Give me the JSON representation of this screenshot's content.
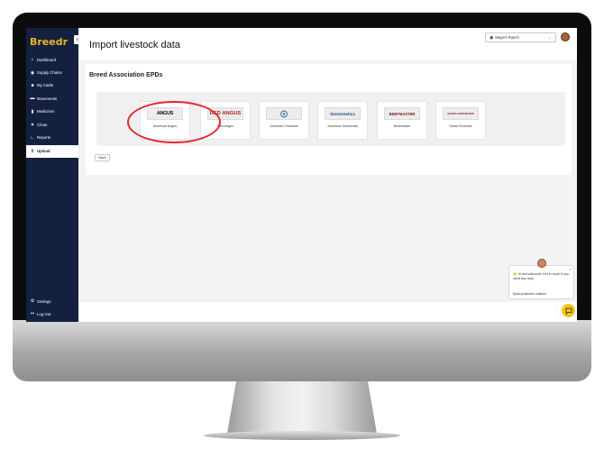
{
  "app": {
    "logo": "Breedr",
    "page_title": "Import livestock data"
  },
  "sidebar": {
    "collapse_icon": "chevron-left-icon",
    "items": [
      {
        "label": "Dashboard",
        "icon": "home-icon"
      },
      {
        "label": "Supply Chains",
        "icon": "eye-icon"
      },
      {
        "label": "My Cattle",
        "icon": "cow-icon"
      },
      {
        "label": "Movements",
        "icon": "truck-icon"
      },
      {
        "label": "Medicines",
        "icon": "bottle-icon"
      },
      {
        "label": "Chute",
        "icon": "barn-icon"
      },
      {
        "label": "Reports",
        "icon": "chart-icon"
      },
      {
        "label": "Upload",
        "icon": "upload-icon",
        "active": true
      }
    ],
    "bottom": [
      {
        "label": "Settings",
        "icon": "gear-icon"
      },
      {
        "label": "Log Out",
        "icon": "logout-icon"
      }
    ]
  },
  "header": {
    "ranch_selector": "Maya's Ranch"
  },
  "main": {
    "section_title": "Breed Association EPDs",
    "breeds": [
      {
        "label": "American Angus",
        "logo_text": "ANGUS"
      },
      {
        "label": "Red Angus",
        "logo_text": "RED ANGUS"
      },
      {
        "label": "American Charolais",
        "logo_text": ""
      },
      {
        "label": "American Simmental",
        "logo_text": "SimGenetics"
      },
      {
        "label": "Beefmaster",
        "logo_text": "BEEFMASTER"
      },
      {
        "label": "Santa Gertrudis",
        "logo_text": "SANTA GERTRUDIS"
      }
    ],
    "back_label": "Back"
  },
  "chat": {
    "message": "Hi and welcome! Get in touch if you need any help.",
    "wave": "👋",
    "spam_notice": "Spam protection enabled"
  },
  "colors": {
    "sidebar_bg": "#13213f",
    "accent": "#f0b323",
    "highlight": "#e6252b",
    "chat_button": "#f7c418"
  }
}
